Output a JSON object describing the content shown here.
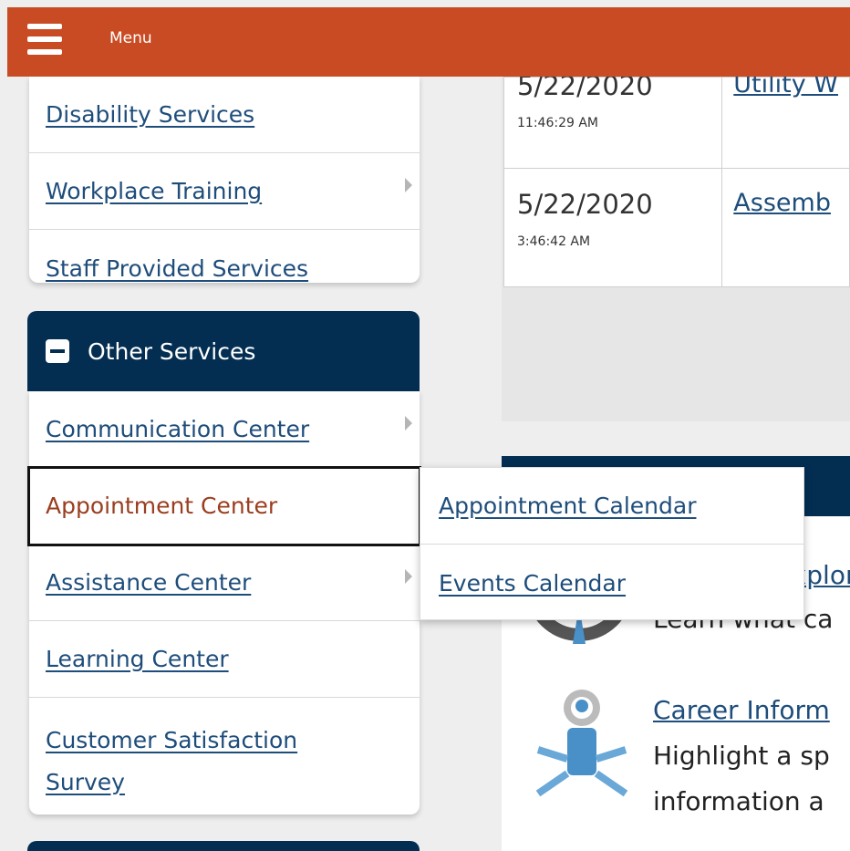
{
  "topbar": {
    "menu_label": "Menu",
    "color": "#c94b23"
  },
  "sidebar_top": {
    "items": [
      {
        "label": "Disability Services",
        "has_submenu": false
      },
      {
        "label": "Workplace Training",
        "has_submenu": true
      },
      {
        "label": "Staff Provided Services",
        "has_submenu": false
      }
    ]
  },
  "other_services": {
    "title": "Other Services",
    "items": [
      {
        "label": "Communication Center",
        "has_submenu": true
      },
      {
        "label": "Appointment Center",
        "has_submenu": true,
        "active": true
      },
      {
        "label": "Assistance Center",
        "has_submenu": true
      },
      {
        "label": "Learning Center",
        "has_submenu": false
      },
      {
        "label": "Customer Satisfaction Survey",
        "has_submenu": false
      }
    ]
  },
  "flyout": {
    "items": [
      {
        "label": "Appointment Calendar"
      },
      {
        "label": "Events Calendar"
      }
    ]
  },
  "table": {
    "rows": [
      {
        "date": "5/22/2020",
        "time": "11:46:29 AM",
        "title": "Utility W"
      },
      {
        "date": "5/22/2020",
        "time": "3:46:42 AM",
        "title": "Assemb"
      }
    ]
  },
  "info": {
    "item1_link": "Explor",
    "item1_text": "Learn what ca",
    "item2_link": "Career Inform",
    "item2_line1": "Highlight a sp",
    "item2_line2": "information a"
  },
  "colors": {
    "navy": "#032e52",
    "link": "#1e4d7b",
    "active_text": "#9b3e1f"
  }
}
